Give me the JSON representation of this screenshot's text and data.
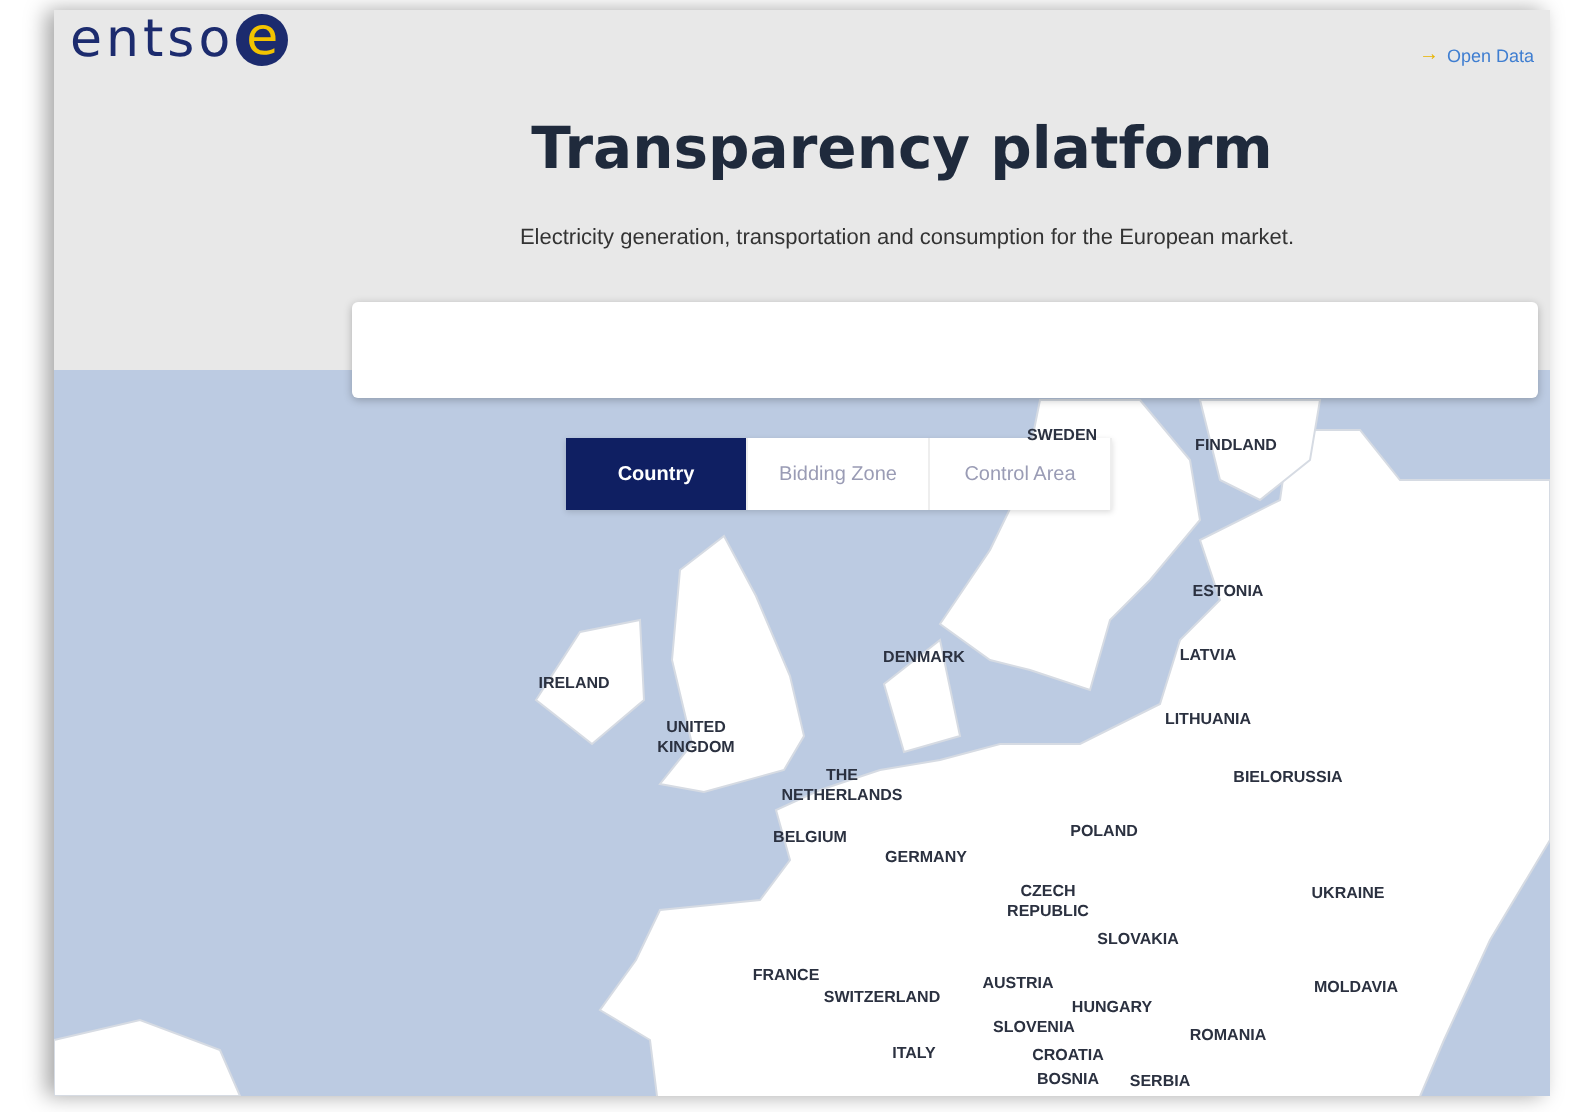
{
  "logo": {
    "text": "entso",
    "mark": "e"
  },
  "header_link": {
    "icon": "→",
    "label": "Open Data"
  },
  "title": "Transparency platform",
  "subtitle": "Electricity generation, transportation and consumption for the European market.",
  "search": {
    "kind": "input"
  },
  "tabs": [
    {
      "label": "Country",
      "selected": true
    },
    {
      "label": "Bidding Zone",
      "selected": false
    },
    {
      "label": "Control Area",
      "selected": false
    }
  ],
  "map_labels": [
    "SWEDEN",
    "FINDLAND",
    "ESTONIA",
    "LATVIA",
    "DENMARK",
    "IRELAND",
    "UNITED\nKINGDOM",
    "LITHUANIA",
    "BIELORUSSIA",
    "THE\nNETHERLANDS",
    "BELGIUM",
    "POLAND",
    "GERMANY",
    "CZECH\nREPUBLIC",
    "UKRAINE",
    "SLOVAKIA",
    "FRANCE",
    "AUSTRIA",
    "MOLDAVIA",
    "SWITZERLAND",
    "HUNGARY",
    "SLOVENIA",
    "ROMANIA",
    "ITALY",
    "CROATIA",
    "BOSNIA",
    "SERBIA"
  ]
}
